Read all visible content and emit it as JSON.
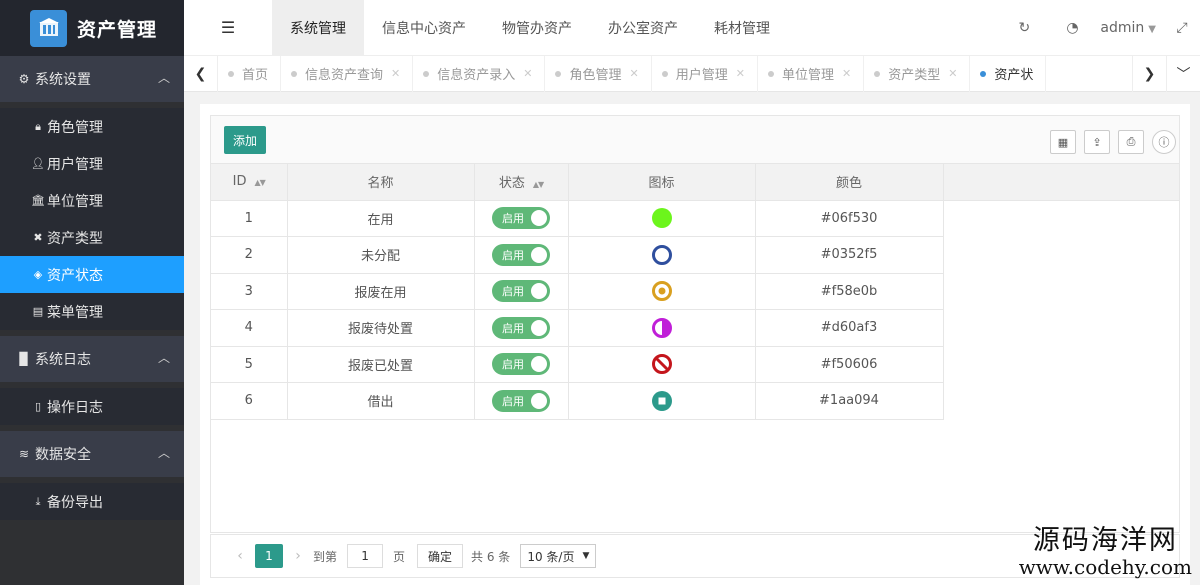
{
  "app": {
    "title": "资产管理"
  },
  "sidebar": {
    "groups": [
      {
        "label": "系统设置",
        "icon": "gears-icon",
        "items": [
          {
            "label": "角色管理",
            "icon": "lock-icon"
          },
          {
            "label": "用户管理",
            "icon": "user-icon"
          },
          {
            "label": "单位管理",
            "icon": "bank-icon"
          },
          {
            "label": "资产类型",
            "icon": "cross-icon"
          },
          {
            "label": "资产状态",
            "icon": "cube-icon",
            "active": true
          },
          {
            "label": "菜单管理",
            "icon": "card-icon"
          }
        ]
      },
      {
        "label": "系统日志",
        "icon": "file-icon",
        "items": [
          {
            "label": "操作日志",
            "icon": "file-text-icon"
          }
        ]
      },
      {
        "label": "数据安全",
        "icon": "database-icon",
        "items": [
          {
            "label": "备份导出",
            "icon": "download-icon"
          }
        ]
      }
    ]
  },
  "topnav": {
    "tabs": [
      "系统管理",
      "信息中心资产",
      "物管办资产",
      "办公室资产",
      "耗材管理"
    ],
    "active": 0,
    "user": "admin"
  },
  "pagetabs": [
    {
      "label": "首页",
      "closable": false
    },
    {
      "label": "信息资产查询",
      "closable": true
    },
    {
      "label": "信息资产录入",
      "closable": true
    },
    {
      "label": "角色管理",
      "closable": true
    },
    {
      "label": "用户管理",
      "closable": true
    },
    {
      "label": "单位管理",
      "closable": true
    },
    {
      "label": "资产类型",
      "closable": true
    },
    {
      "label": "资产状",
      "closable": false,
      "active": true
    }
  ],
  "toolbar": {
    "add_label": "添加"
  },
  "table": {
    "headers": {
      "id": "ID",
      "name": "名称",
      "status": "状态",
      "icon": "图标",
      "color": "颜色"
    },
    "rows": [
      {
        "id": "1",
        "name": "在用",
        "status": "启用",
        "icon": "filled-circle-icon",
        "color": "#06f530"
      },
      {
        "id": "2",
        "name": "未分配",
        "status": "启用",
        "icon": "ring-icon",
        "color": "#0352f5"
      },
      {
        "id": "3",
        "name": "报废在用",
        "status": "启用",
        "icon": "dot-circle-icon",
        "color": "#f58e0b"
      },
      {
        "id": "4",
        "name": "报废待处置",
        "status": "启用",
        "icon": "half-circle-icon",
        "color": "#d60af3"
      },
      {
        "id": "5",
        "name": "报废已处置",
        "status": "启用",
        "icon": "ban-icon",
        "color": "#f50606"
      },
      {
        "id": "6",
        "name": "借出",
        "status": "启用",
        "icon": "stop-circle-icon",
        "color": "#1aa094"
      }
    ]
  },
  "pager": {
    "current": "1",
    "goto_label": "到第",
    "goto_value": "1",
    "page_label": "页",
    "ok_label": "确定",
    "total": "共 6 条",
    "page_size": "10 条/页"
  },
  "watermark": {
    "line1": "源码海洋网",
    "line2": "www.codehy.com"
  }
}
